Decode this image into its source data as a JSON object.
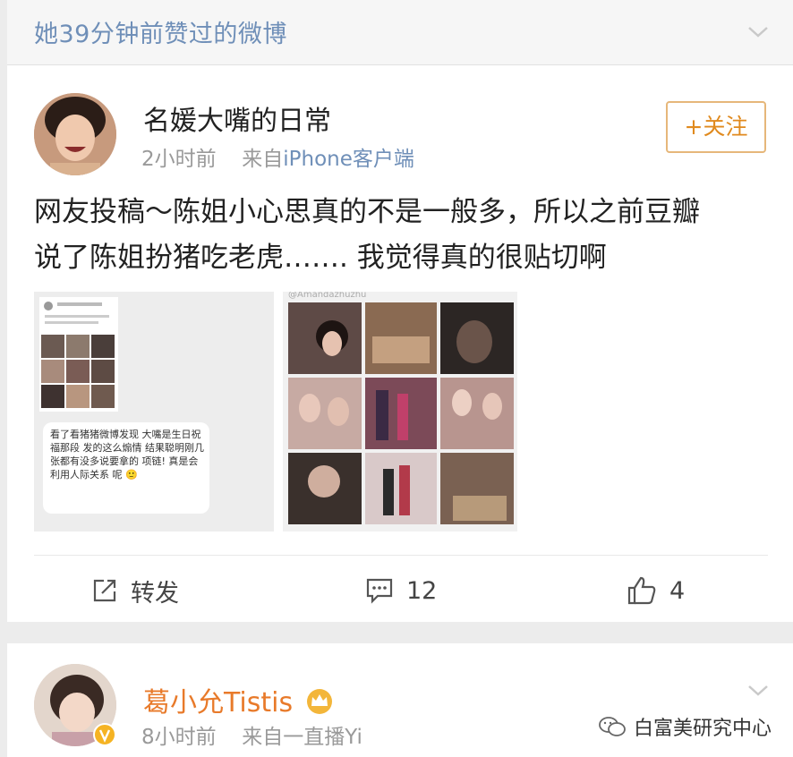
{
  "liked_banner": {
    "text": "她39分钟前赞过的微博"
  },
  "post": {
    "user_name": "名媛大嘴的日常",
    "time": "2小时前",
    "source_prefix": "来自",
    "source": "iPhone客户端",
    "follow_label": "+关注",
    "text_line1": "网友投稿～陈姐小心思真的不是一般多，所以之前豆瓣",
    "text_line2": "说了陈姐扮猪吃老虎……. 我觉得真的很贴切啊",
    "image1_caption": "看了看猪猪微博发现 大嘴是生日祝福那段 发的这么煽情 结果聪明刚几张都有没多说要拿的 项链! 真是会利用人际关系 呢 🙂",
    "image2_handle": "@Amandazhuzhu",
    "actions": {
      "repost_label": "转发",
      "comment_count": "12",
      "like_count": "4"
    }
  },
  "next_post": {
    "user_name": "葛小允Tistis",
    "time": "8小时前",
    "source": "来自一直播Yi"
  },
  "watermark": {
    "text": "白富美研究中心"
  },
  "colors": {
    "link_blue": "#6f8fb8",
    "follow_orange": "#e08a1e",
    "vip_name_orange": "#e87a2a",
    "background": "#ececec"
  },
  "icons": [
    "chevron-down-icon",
    "repost-icon",
    "comment-icon",
    "thumbs-up-icon",
    "crown-badge-icon",
    "wechat-icon"
  ]
}
